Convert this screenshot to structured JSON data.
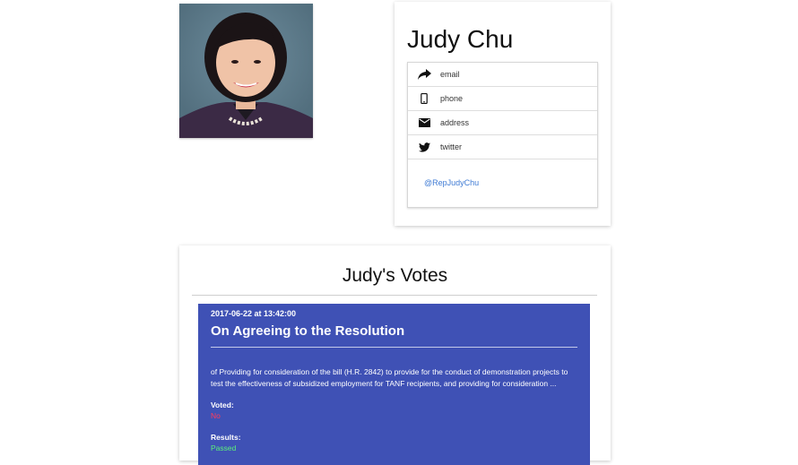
{
  "profile": {
    "name": "Judy Chu",
    "contacts": [
      {
        "icon": "share-arrow-icon",
        "label": "email"
      },
      {
        "icon": "phone-icon",
        "label": "phone"
      },
      {
        "icon": "envelope-icon",
        "label": "address"
      },
      {
        "icon": "twitter-icon",
        "label": "twitter"
      }
    ],
    "twitter_handle": "@RepJudyChu"
  },
  "votes": {
    "title": "Judy's Votes",
    "items": [
      {
        "date": "2017-06-22 at 13:42:00",
        "question": "On Agreeing to the Resolution",
        "description": "of Providing for consideration of the bill (H.R. 2842) to provide for the conduct of demonstration projects to test the effectiveness of subsidized employment for TANF recipients, and providing for consideration ...",
        "voted_label": "Voted:",
        "voted_value": "No",
        "results_label": "Results:",
        "results_value": "Passed"
      }
    ]
  },
  "colors": {
    "vote_card_bg": "#3f51b5",
    "vote_no": "#ff3b5c",
    "result_passed": "#5cf07a",
    "link": "#3f7bd4"
  }
}
